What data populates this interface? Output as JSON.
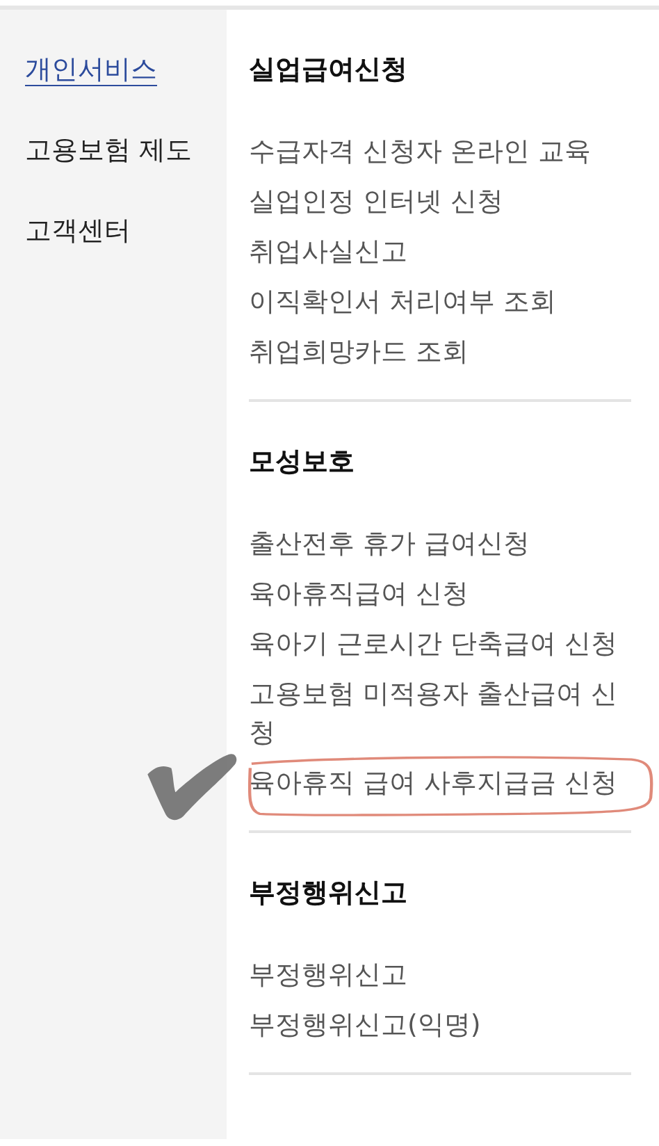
{
  "sidebar": {
    "items": [
      {
        "label": "개인서비스",
        "selected": true
      },
      {
        "label": "고용보험 제도",
        "selected": false
      },
      {
        "label": "고객센터",
        "selected": false
      }
    ]
  },
  "sections": [
    {
      "heading": "실업급여신청",
      "items": [
        {
          "label": "수급자격 신청자 온라인 교육",
          "circled": false
        },
        {
          "label": "실업인정 인터넷 신청",
          "circled": false
        },
        {
          "label": "취업사실신고",
          "circled": false
        },
        {
          "label": "이직확인서 처리여부 조회",
          "circled": false
        },
        {
          "label": "취업희망카드 조회",
          "circled": false
        }
      ]
    },
    {
      "heading": "모성보호",
      "items": [
        {
          "label": "출산전후 휴가 급여신청",
          "circled": false
        },
        {
          "label": "육아휴직급여 신청",
          "circled": false
        },
        {
          "label": "육아기 근로시간 단축급여 신청",
          "circled": false
        },
        {
          "label": "고용보험 미적용자 출산급여 신청",
          "circled": false
        },
        {
          "label": "육아휴직 급여 사후지급금 신청",
          "circled": true
        }
      ]
    },
    {
      "heading": "부정행위신고",
      "items": [
        {
          "label": "부정행위신고",
          "circled": false
        },
        {
          "label": "부정행위신고(익명)",
          "circled": false
        }
      ]
    }
  ]
}
